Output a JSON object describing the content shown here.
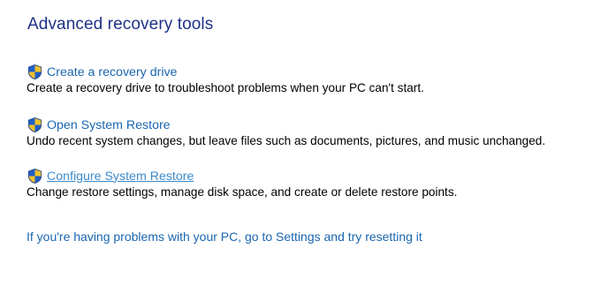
{
  "page": {
    "title": "Advanced recovery tools"
  },
  "tools": [
    {
      "link": "Create a recovery drive",
      "description": "Create a recovery drive to troubleshoot problems when your PC can't start.",
      "icon": "uac-shield-icon"
    },
    {
      "link": "Open System Restore",
      "description": "Undo recent system changes, but leave files such as documents, pictures, and music unchanged.",
      "icon": "uac-shield-icon"
    },
    {
      "link": "Configure System Restore",
      "description": "Change restore settings, manage disk space, and create or delete restore points.",
      "icon": "uac-shield-icon"
    }
  ],
  "footer": {
    "reset_link": "If you're having problems with your PC, go to Settings and try resetting it"
  },
  "colors": {
    "title": "#1e3287",
    "link": "#1a66b0",
    "link_hover": "#3b89c9",
    "text": "#000000"
  }
}
